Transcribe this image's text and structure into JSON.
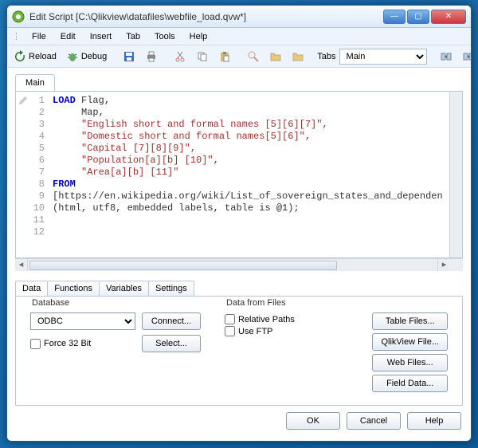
{
  "title": "Edit Script [C:\\Qlikview\\datafiles\\webfile_load.qvw*]",
  "menu": {
    "file": "File",
    "edit": "Edit",
    "insert": "Insert",
    "tab": "Tab",
    "tools": "Tools",
    "help": "Help"
  },
  "toolbar": {
    "reload": "Reload",
    "debug": "Debug",
    "tabs_label": "Tabs",
    "tab_selected": "Main"
  },
  "script_tab": "Main",
  "code": {
    "line_count": 12,
    "l1_kw": "LOAD",
    "l1_rest": " Flag,",
    "l2": "     Map,",
    "l3": "     \"English short and formal names [5][6][7]\",",
    "l4": "     \"Domestic short and formal names[5][6]\",",
    "l5": "     \"Capital [7][8][9]\",",
    "l6": "     \"Population[a][b] [10]\",",
    "l7": "     \"Area[a][b] [11]\"",
    "l8": "FROM",
    "l9": "[https://en.wikipedia.org/wiki/List_of_sovereign_states_and_dependen",
    "l10": "(html, utf8, embedded labels, table is @1);"
  },
  "bottom_tabs": {
    "data": "Data",
    "functions": "Functions",
    "variables": "Variables",
    "settings": "Settings"
  },
  "data_panel": {
    "database_title": "Database",
    "db_selected": "ODBC",
    "connect": "Connect...",
    "select": "Select...",
    "force32": "Force 32 Bit",
    "files_title": "Data from Files",
    "relative": "Relative Paths",
    "useftp": "Use FTP",
    "table_files": "Table Files...",
    "qlikview_file": "QlikView File...",
    "web_files": "Web Files...",
    "field_data": "Field Data..."
  },
  "dialog_buttons": {
    "ok": "OK",
    "cancel": "Cancel",
    "help": "Help"
  }
}
